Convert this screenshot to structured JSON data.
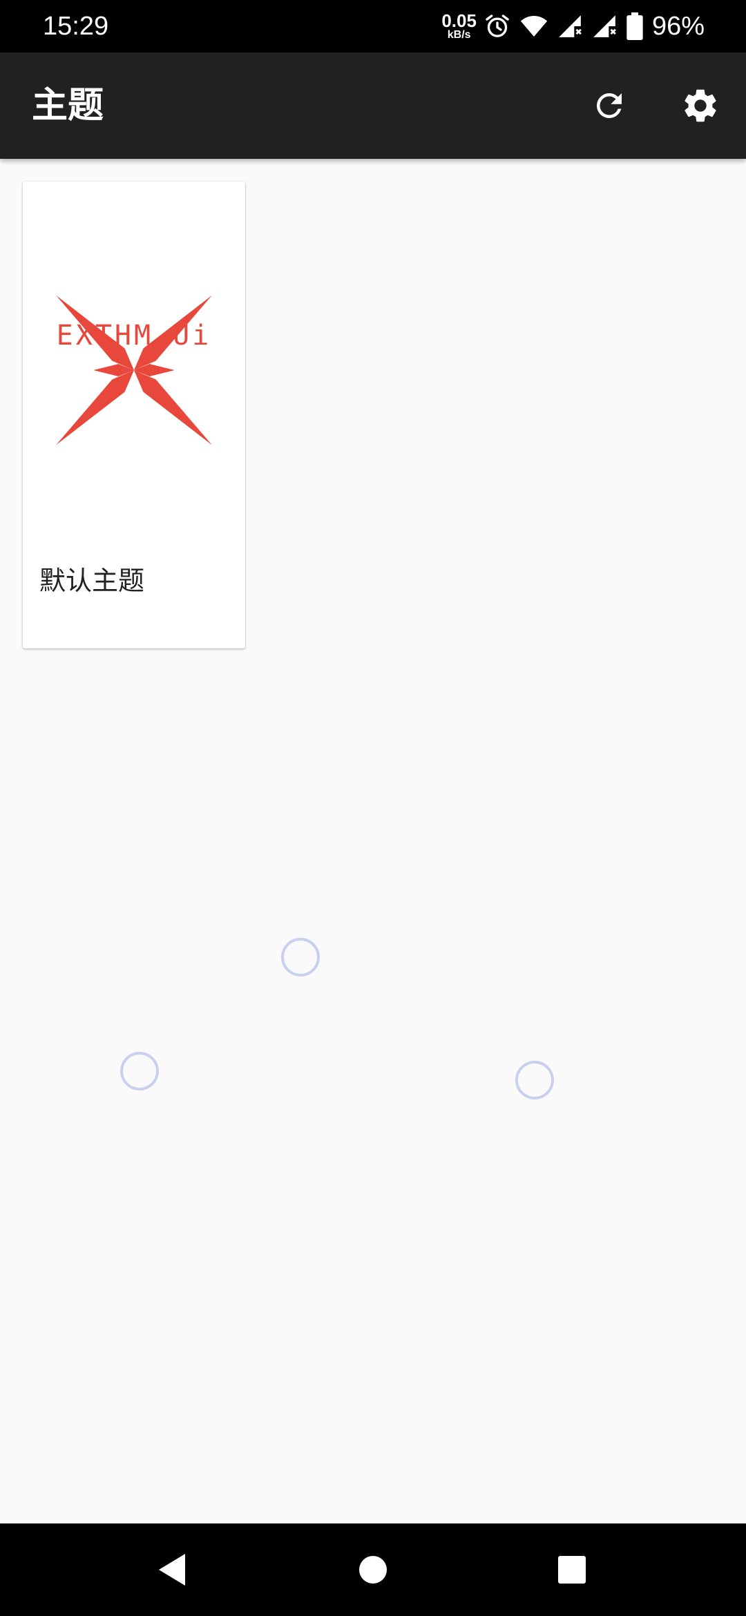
{
  "status_bar": {
    "time": "15:29",
    "net_speed_value": "0.05",
    "net_speed_unit": "kB/s",
    "battery_percent": "96%"
  },
  "app_bar": {
    "title": "主题",
    "actions": [
      "refresh-icon",
      "gear-icon"
    ]
  },
  "themes": [
    {
      "name": "默认主题",
      "logo_text": "EXTHM Ui",
      "logo_color": "#e8473b"
    }
  ],
  "colors": {
    "app_bar": "#212121",
    "background": "#fafafa",
    "accent_logo": "#e8473b",
    "loader_ring": "#c9cfee"
  },
  "nav_bar": {
    "buttons": [
      "back-icon",
      "home-icon",
      "recents-icon"
    ]
  }
}
